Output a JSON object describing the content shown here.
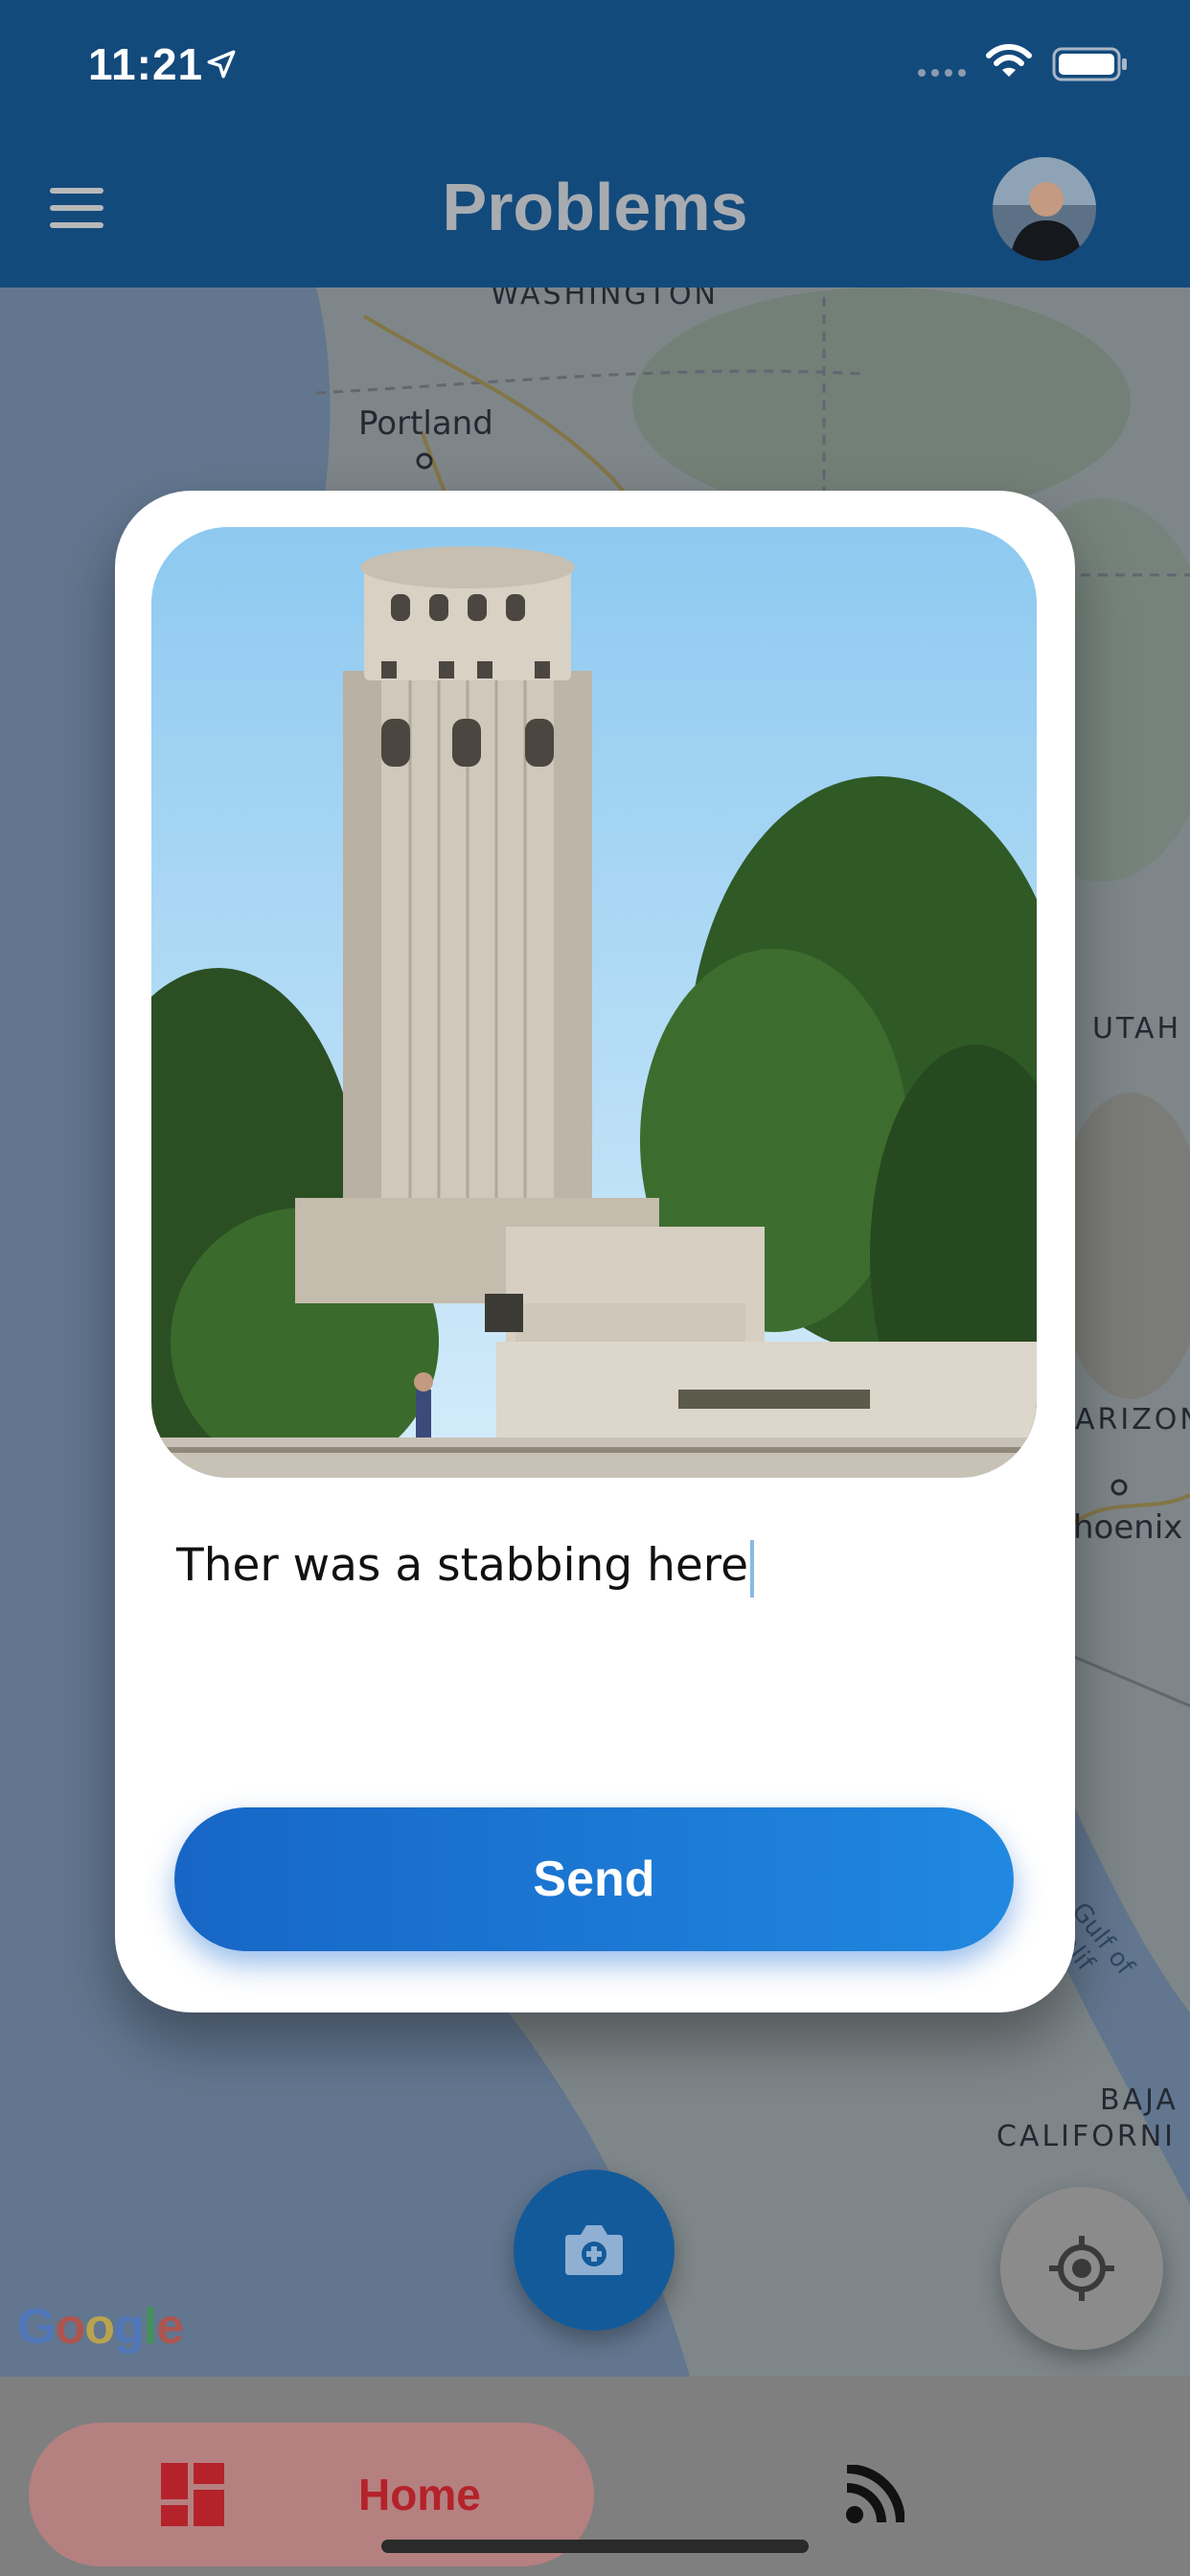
{
  "status_bar": {
    "time": "11:21"
  },
  "app_bar": {
    "title": "Problems",
    "menu_icon": "hamburger-menu-icon",
    "avatar_icon": "user-avatar"
  },
  "map": {
    "labels": {
      "washington": "WASHINGTON",
      "portland": "Portland",
      "utah": "UTAH",
      "arizona": "ARIZON",
      "phoenix": "hoenix",
      "gulf": "Gulf of Calif",
      "baja_1": "BAJA",
      "baja_2": "CALIFORNI"
    },
    "attribution": "Google"
  },
  "dialog": {
    "photo_subject": "Coit Tower",
    "report_text": "Ther was a stabbing here",
    "send_label": "Send"
  },
  "fabs": {
    "camera_icon": "camera-plus-icon",
    "locate_icon": "gps-locate-icon"
  },
  "bottom_nav": {
    "home_label": "Home",
    "home_icon": "dashboard-icon",
    "feed_icon": "rss-feed-icon"
  },
  "colors": {
    "app_bar": "#134a7c",
    "send_button_start": "#1766c6",
    "send_button_end": "#2088e0",
    "home_active": "#b4222a"
  }
}
